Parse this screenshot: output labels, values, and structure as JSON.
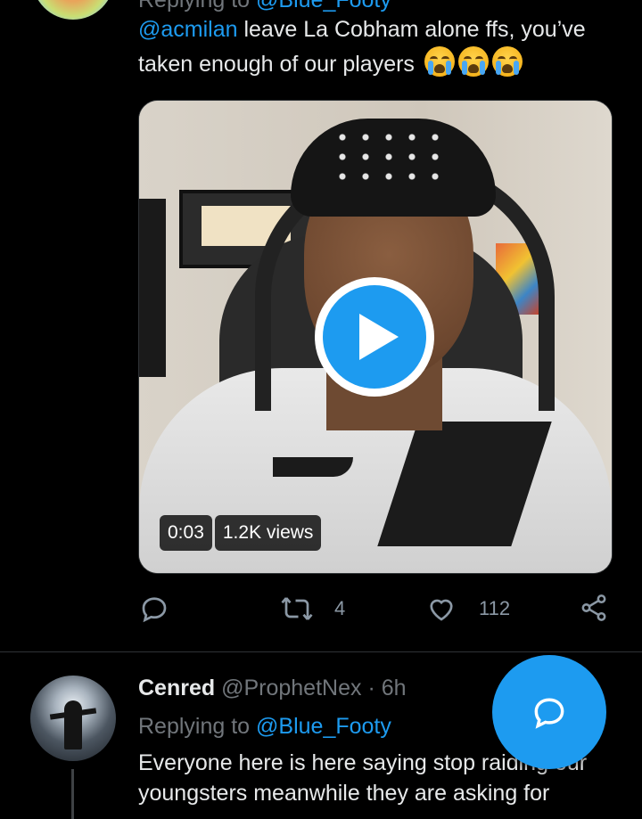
{
  "tweet1": {
    "replying_label": "Replying to",
    "replying_handle": "@Blue_Footy",
    "text_mention": "@acmilan",
    "text_line1": " leave La Cobham alone ffs, you’ve",
    "text_line2": "taken enough of our players",
    "emoji_name": "loudly-crying-face",
    "video": {
      "duration": "0:03",
      "views": "1.2K views"
    },
    "actions": {
      "reply_count": "",
      "retweet_count": "4",
      "like_count": "112"
    }
  },
  "tweet2": {
    "name": "Cenred",
    "handle": "@ProphetNex",
    "separator": "·",
    "time": "6h",
    "more": "·",
    "replying_label": "Replying to",
    "replying_handle": "@Blue_Footy",
    "text_line1": "Everyone here is here saying stop raiding our",
    "text_line2": "youngsters meanwhile they are asking for"
  },
  "colors": {
    "background": "#000000",
    "accent": "#1d9bf0",
    "muted": "#71767b",
    "text": "#e7e9ea"
  },
  "icons": {
    "reply": "reply-icon",
    "retweet": "retweet-icon",
    "like": "heart-icon",
    "share": "share-icon",
    "play": "play-icon",
    "compose": "compose-reply-icon"
  }
}
